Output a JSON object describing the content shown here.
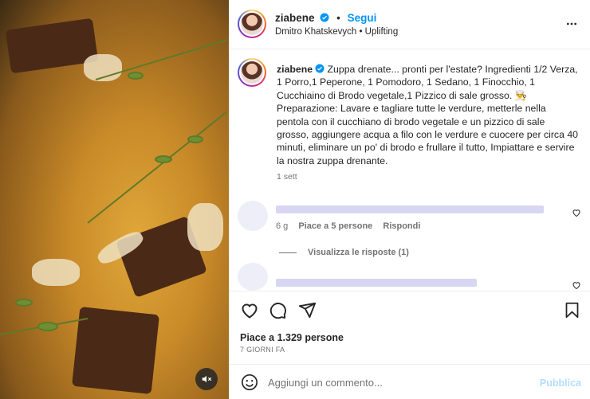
{
  "post": {
    "username": "ziabene",
    "follow_label": "Segui",
    "audio_line": "Dmitro Khatskevych • Uplifting"
  },
  "caption": {
    "username": "ziabene",
    "text": "Zuppa drenate... pronti per l'estate? Ingredienti 1/2 Verza, 1 Porro,1 Peperone, 1 Pomodoro, 1 Sedano, 1 Finocchio, 1 Cucchiaino di Brodo vegetale,1 Pizzico di sale grosso. 👨‍🍳 Preparazione: Lavare e tagliare tutte le verdure, metterle nella pentola con il cucchiano di brodo vegetale e un pizzico di sale grosso, aggiungere acqua a filo con le verdure e cuocere per circa 40 minuti, eliminare un po' di brodo e frullare il tutto, Impiattare e servire la nostra zuppa drenante.",
    "time": "1 sett"
  },
  "comments": [
    {
      "time": "6 g",
      "likes_label": "Piace a 5 persone",
      "reply_label": "Rispondi",
      "view_replies": "Visualizza le risposte (1)"
    }
  ],
  "engagement": {
    "likes_text": "Piace a 1.329 persone",
    "date": "7 GIORNI FA"
  },
  "composer": {
    "placeholder": "Aggiungi un commento...",
    "publish_label": "Pubblica"
  },
  "icons": {
    "verified": "verified-badge-icon",
    "more": "more-options-icon",
    "mute": "muted-speaker-icon",
    "like": "heart-icon",
    "comment": "comment-bubble-icon",
    "share": "paper-plane-icon",
    "save": "bookmark-icon",
    "emoji": "emoji-smiley-icon"
  },
  "colors": {
    "accent": "#0095f6",
    "publish_disabled": "#b2dffc",
    "muted_text": "#737373"
  }
}
